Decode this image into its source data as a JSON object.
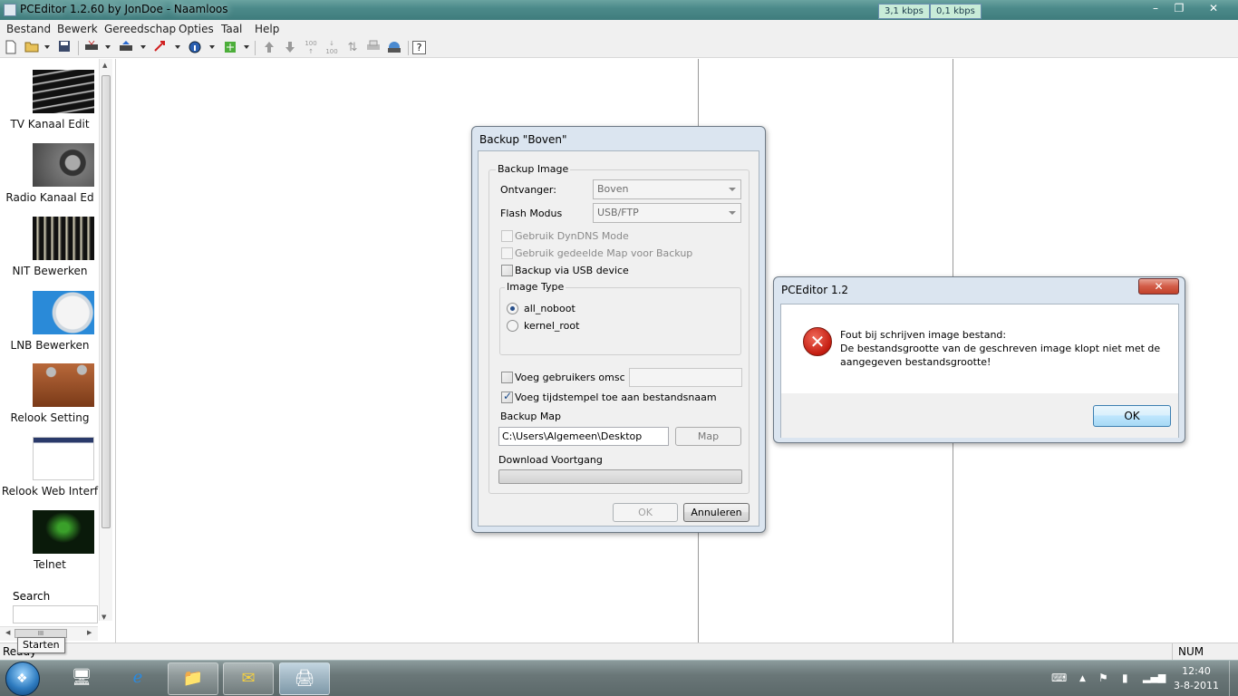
{
  "window": {
    "title": "PCEditor 1.2.60 by JonDoe - Naamloos",
    "net_down": "3,1 kbps",
    "net_up": "0,1 kbps"
  },
  "menu": [
    "Bestand",
    "Bewerk",
    "Gereedschap",
    "Opties",
    "Taal",
    "Help"
  ],
  "toolbar": {
    "icons": [
      "new-document-icon",
      "open-folder-icon",
      "save-icon",
      "receiver-icon",
      "upload-icon",
      "download-arrow-icon",
      "info-globe-icon",
      "satellite-icon",
      "move-up-icon",
      "move-down-icon",
      "sort-up-icon",
      "sort-down-icon",
      "sort-numeric-icon",
      "print-icon",
      "network-icon",
      "help-icon"
    ],
    "glyphs": {
      "sort_up": "100",
      "sort_down": "100",
      "help": "?"
    }
  },
  "sidebar": {
    "items": [
      {
        "label": "TV Kanaal Edit",
        "thumb": "tv-thumbnail"
      },
      {
        "label": "Radio Kanaal Ed",
        "thumb": "radio-thumbnail"
      },
      {
        "label": "NIT Bewerken",
        "thumb": "nit-thumbnail"
      },
      {
        "label": "LNB Bewerken",
        "thumb": "lnb-thumbnail"
      },
      {
        "label": "Relook Setting",
        "thumb": "relook-thumbnail"
      },
      {
        "label": "Relook Web Interf",
        "thumb": "web-thumbnail"
      },
      {
        "label": "Telnet",
        "thumb": "telnet-thumbnail"
      }
    ],
    "search_label": "Search",
    "scroll_grip": "III"
  },
  "backup_dialog": {
    "title": "Backup \"Boven\"",
    "group_backup_image": "Backup Image",
    "receiver_label": "Ontvanger:",
    "receiver_value": "Boven",
    "flash_label": "Flash Modus",
    "flash_value": "USB/FTP",
    "dyndns_label": "Gebruik DynDNS Mode",
    "shared_map_label": "Gebruik gedeelde Map voor Backup",
    "usb_label": "Backup via USB device",
    "group_image_type": "Image Type",
    "radio_noboot": "all_noboot",
    "radio_kernel": "kernel_root",
    "user_desc_label": "Voeg gebruikers omschrijv",
    "timestamp_label": "Voeg tijdstempel toe aan bestandsnaam",
    "backup_map_label": "Backup Map",
    "backup_map_value": "C:\\Users\\Algemeen\\Desktop",
    "map_button": "Map",
    "download_label": "Download Voortgang",
    "download_progress": 0,
    "ok_button": "OK",
    "cancel_button": "Annuleren"
  },
  "error_dialog": {
    "title": "PCEditor 1.2",
    "close": "✕",
    "line1": "Fout bij schrijven image bestand:",
    "line2": "De bestandsgrootte van de geschreven image klopt niet met de",
    "line3": "aangegeven bestandsgrootte!",
    "ok_button": "OK"
  },
  "statusbar": {
    "status": "Ready",
    "num": "NUM"
  },
  "tooltip": "Starten",
  "taskbar": {
    "time": "12:40",
    "date": "3-8-2011"
  },
  "colors": {
    "error_red": "#c41c10",
    "dialog_frame": "#dbe5f0",
    "default_button": "#a7d9f5"
  }
}
